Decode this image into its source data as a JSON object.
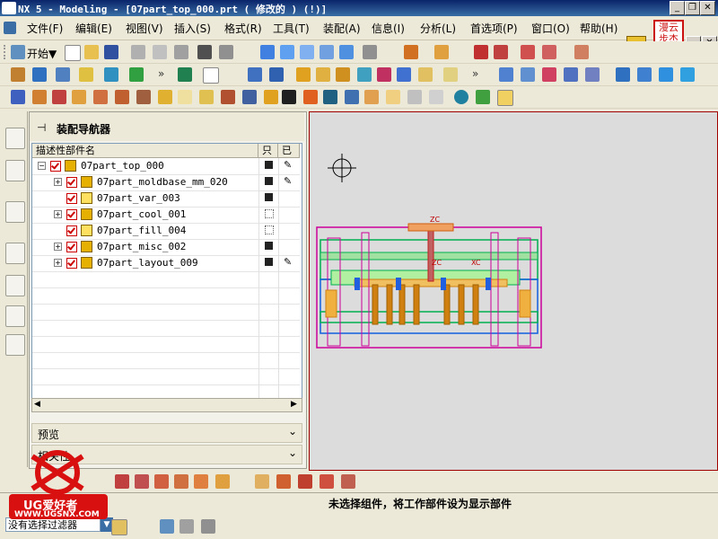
{
  "window": {
    "title": "NX 5 - Modeling - [07part_top_000.prt ( 修改的 )     (!)]",
    "buttons": [
      "_",
      "❐",
      "✕"
    ]
  },
  "menubar": {
    "items": [
      "文件(F)",
      "编辑(E)",
      "视图(V)",
      "插入(S)",
      "格式(R)",
      "工具(T)",
      "装配(A)",
      "信息(I)",
      "分析(L)",
      "首选项(P)",
      "窗口(O)",
      "帮助(H)"
    ]
  },
  "toolbar1": {
    "start_label": "开始▼"
  },
  "brand_stamp": {
    "text": "漫云步杰",
    "color": "#cc1111"
  },
  "navigator": {
    "title": "装配导航器",
    "columns": [
      "描述性部件名",
      "只",
      "已"
    ],
    "rows": [
      {
        "name": "07part_top_000",
        "level": 0,
        "type": "assembly",
        "expander": "⊟",
        "readonly": true,
        "edit": true
      },
      {
        "name": "07part_moldbase_mm_020",
        "level": 1,
        "type": "assembly",
        "expander": "⊞",
        "readonly": true,
        "edit": true
      },
      {
        "name": "07part_var_003",
        "level": 1,
        "type": "component",
        "expander": "",
        "readonly": true,
        "edit": false
      },
      {
        "name": "07part_cool_001",
        "level": 1,
        "type": "assembly",
        "expander": "⊞",
        "readonly": false,
        "edit": false
      },
      {
        "name": "07part_fill_004",
        "level": 1,
        "type": "component",
        "expander": "",
        "readonly": false,
        "edit": false
      },
      {
        "name": "07part_misc_002",
        "level": 1,
        "type": "assembly",
        "expander": "⊞",
        "readonly": true,
        "edit": false
      },
      {
        "name": "07part_layout_009",
        "level": 1,
        "type": "assembly",
        "expander": "⊞",
        "readonly": true,
        "edit": true
      }
    ],
    "sections": [
      "预览",
      "相关性"
    ]
  },
  "viewport": {
    "labels": {
      "zc_top": "ZC",
      "zc_mid": "ZC",
      "xc": "XC"
    }
  },
  "status": {
    "prompt": "未选择组件，将工作部件设为显示部件"
  },
  "filter": {
    "selected": "没有选择过滤器"
  },
  "watermark": {
    "brand": "UG爱好者",
    "url": "WWW.UGSNX.COM"
  },
  "colors": {
    "accent": "#0a246a",
    "model_magenta": "#cc0099",
    "model_green": "#00b050",
    "model_blue": "#1060e0",
    "model_orange": "#d08010"
  }
}
